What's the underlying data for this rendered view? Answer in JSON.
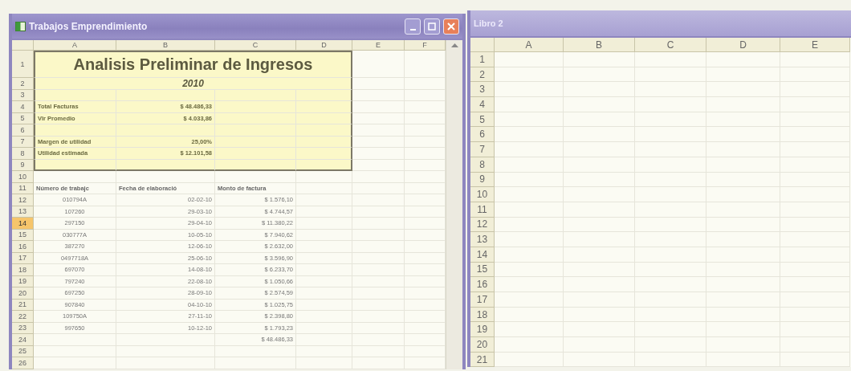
{
  "workbooks": [
    {
      "title": "Trabajos Emprendimiento",
      "controls": true,
      "columns": [
        "A",
        "B",
        "C",
        "D",
        "E",
        "F"
      ],
      "rows": [
        {
          "label": "1",
          "selected": false
        },
        {
          "label": "2",
          "selected": false
        },
        {
          "label": "3",
          "selected": false
        },
        {
          "label": "4",
          "selected": false
        },
        {
          "label": "5",
          "selected": false
        },
        {
          "label": "6",
          "selected": false
        },
        {
          "label": "7",
          "selected": false
        },
        {
          "label": "8",
          "selected": false
        },
        {
          "label": "9",
          "selected": false
        },
        {
          "label": "10",
          "selected": false
        },
        {
          "label": "11",
          "selected": false
        },
        {
          "label": "12",
          "selected": false
        },
        {
          "label": "13",
          "selected": false
        },
        {
          "label": "14",
          "selected": true
        },
        {
          "label": "15",
          "selected": false
        },
        {
          "label": "16",
          "selected": false
        },
        {
          "label": "17",
          "selected": false
        },
        {
          "label": "18",
          "selected": false
        },
        {
          "label": "19",
          "selected": false
        },
        {
          "label": "20",
          "selected": false
        },
        {
          "label": "21",
          "selected": false
        },
        {
          "label": "22",
          "selected": false
        },
        {
          "label": "23",
          "selected": false
        },
        {
          "label": "24",
          "selected": false
        },
        {
          "label": "25",
          "selected": false
        },
        {
          "label": "26",
          "selected": false
        }
      ],
      "report": {
        "title": "Analisis Preliminar de Ingresos",
        "year": "2010",
        "summary": [
          {
            "label": "Total Facturas",
            "value": "$ 48.486,33"
          },
          {
            "label": "Vlr Promedio",
            "value": "$ 4.033,86"
          },
          {
            "label": "Margen de utilidad",
            "value": "25,00%"
          },
          {
            "label": "Utilidad estimada",
            "value": "$ 12.101,58"
          }
        ]
      },
      "table": {
        "columns": [
          "Número de trabajc",
          "Fecha de elaboració",
          "Monto de factura"
        ],
        "rows": [
          [
            "010794A",
            "02-02-10",
            "$ 1.576,10"
          ],
          [
            "107260",
            "29-03-10",
            "$ 4.744,57"
          ],
          [
            "297150",
            "29-04-10",
            "$ 11.380,22"
          ],
          [
            "030777A",
            "10-05-10",
            "$ 7.940,62"
          ],
          [
            "387270",
            "12-06-10",
            "$ 2.632,00"
          ],
          [
            "0497718A",
            "25-06-10",
            "$ 3.596,90"
          ],
          [
            "697070",
            "14-08-10",
            "$ 6.233,70"
          ],
          [
            "797240",
            "22-08-10",
            "$ 1.050,66"
          ],
          [
            "697250",
            "28-09-10",
            "$ 2.574,59"
          ],
          [
            "907840",
            "04-10-10",
            "$ 1.025,75"
          ],
          [
            "109750A",
            "27-11-10",
            "$ 2.398,80"
          ],
          [
            "997650",
            "10-12-10",
            "$ 1.793,23"
          ]
        ],
        "total": "$ 48.486,33"
      }
    },
    {
      "title": "Libro 2",
      "controls": false,
      "columns": [
        "A",
        "B",
        "C",
        "D",
        "E"
      ],
      "rows": [
        {
          "label": "1",
          "selected": false
        },
        {
          "label": "2",
          "selected": false
        },
        {
          "label": "3",
          "selected": false
        },
        {
          "label": "4",
          "selected": false
        },
        {
          "label": "5",
          "selected": false
        },
        {
          "label": "6",
          "selected": false
        },
        {
          "label": "7",
          "selected": false
        },
        {
          "label": "8",
          "selected": false
        },
        {
          "label": "9",
          "selected": false
        },
        {
          "label": "10",
          "selected": false
        },
        {
          "label": "11",
          "selected": false
        },
        {
          "label": "12",
          "selected": false
        },
        {
          "label": "13",
          "selected": false
        },
        {
          "label": "14",
          "selected": false
        },
        {
          "label": "15",
          "selected": false
        },
        {
          "label": "16",
          "selected": false
        },
        {
          "label": "17",
          "selected": false
        },
        {
          "label": "18",
          "selected": false
        },
        {
          "label": "19",
          "selected": false
        },
        {
          "label": "20",
          "selected": false
        },
        {
          "label": "21",
          "selected": false
        }
      ]
    }
  ]
}
